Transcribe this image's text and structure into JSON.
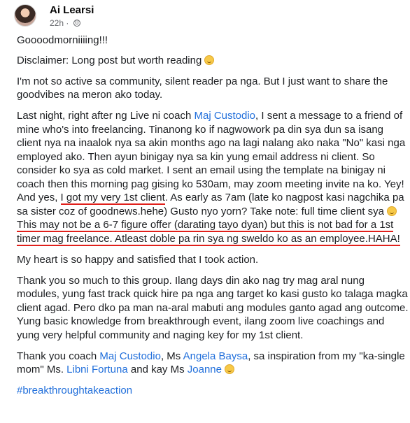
{
  "post": {
    "author": "Ai Learsi",
    "time": "22h",
    "dot": "·",
    "greeting": "Goooodmorniiiing!!!",
    "disclaimer": "Disclaimer: Long post but worth reading",
    "intro": "I'm not so active sa community, silent reader pa nga. But I just want to share the goodvibes na meron ako today.",
    "story_a": "Last night, right after ng Live ni coach ",
    "coach_link": "Maj Custodio",
    "story_b": ", I sent a message to a friend of mine who's into freelancing. Tinanong ko if nagwowork pa din sya dun sa isang client nya na inaalok nya sa akin months ago na lagi nalang ako naka \"No\" kasi nga employed ako. Then ayun binigay nya sa kin yung email address ni client. So consider ko sya as cold market. I sent an email using the template na binigay ni coach then this morning pag gising ko 530am, may zoom meeting invite na ko. Yey! And yes, ",
    "story_ul1": "I got my very 1st client",
    "story_c": ". As early as 7am (late ko nagpost kasi nagchika pa sa sister coz of goodnews.hehe) Gusto nyo yorn? Take note: full time client sya ",
    "story_ul2": "This may not be a 6-7 figure offer (darating tayo dyan) but this is not bad for a 1st timer mag freelance. Atleast doble pa rin sya ng sweldo ko as an employee.HAHA!",
    "heart": "My heart is so happy and satisfied that I took action.",
    "thanks": "Thank you so much to this group. Ilang days din ako nag try mag aral nung modules, yung  fast track quick hire pa nga ang target ko kasi gusto ko talaga magka client agad. Pero dko pa man na-aral mabuti ang modules ganto agad ang outcome. Yung basic knowledge from breakthrough event, ilang zoom live coachings and yung very helpful community and naging key for my 1st client.",
    "thanks2_a": "Thank you coach ",
    "thanks2_link1": "Maj Custodio",
    "thanks2_b": ", Ms ",
    "thanks2_link2": "Angela Baysa",
    "thanks2_c": ", sa inspiration from my \"ka-single mom\" Ms. ",
    "thanks2_link3": "Libni Fortuna",
    "thanks2_d": " and kay Ms ",
    "thanks2_link4": "Joanne",
    "hashtag": "#breakthroughtakeaction"
  },
  "colors": {
    "link": "#216fdb",
    "underline": "#e0201b"
  },
  "icons": [
    "globe-icon",
    "smile-emoji-icon"
  ]
}
